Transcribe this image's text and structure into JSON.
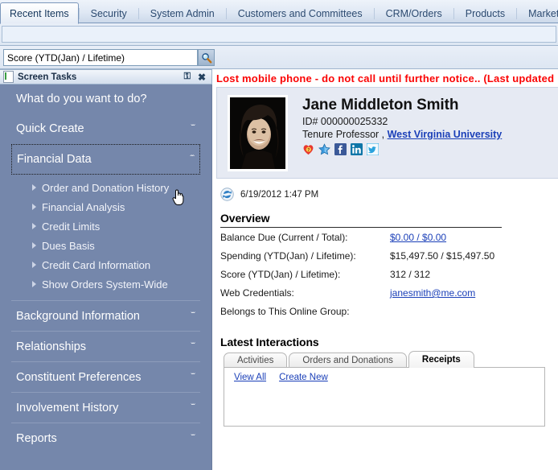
{
  "window": {
    "tabs": [
      {
        "label": "Recent Items",
        "active": true
      },
      {
        "label": "Security",
        "active": false
      },
      {
        "label": "System Admin",
        "active": false
      },
      {
        "label": "Customers and Committees",
        "active": false
      },
      {
        "label": "CRM/Orders",
        "active": false
      },
      {
        "label": "Products",
        "active": false
      },
      {
        "label": "Marketing",
        "active": false
      }
    ]
  },
  "search": {
    "value": "Score (YTD(Jan) / Lifetime)",
    "placeholder": "",
    "button_icon": "magnifier-icon"
  },
  "sidebar": {
    "panel_title": "Screen Tasks",
    "panel_icon": "document-icon",
    "pin_icon": "pin-icon",
    "close_icon": "close-icon",
    "question": "What do you want to do?",
    "sections": [
      {
        "label": "Quick Create",
        "expanded": false,
        "chevron": "ˇˇ"
      },
      {
        "label": "Financial Data",
        "expanded": true,
        "chevron": "ˆˆ"
      },
      {
        "label": "Background Information",
        "expanded": false,
        "chevron": "ˇˇ"
      },
      {
        "label": "Relationships",
        "expanded": false,
        "chevron": "ˇˇ"
      },
      {
        "label": "Constituent Preferences",
        "expanded": false,
        "chevron": "ˇˇ"
      },
      {
        "label": "Involvement History",
        "expanded": false,
        "chevron": "ˇˇ"
      },
      {
        "label": "Reports",
        "expanded": false,
        "chevron": "ˇˇ"
      }
    ],
    "financial_items": [
      {
        "label": "Order and Donation History"
      },
      {
        "label": "Financial Analysis"
      },
      {
        "label": "Credit Limits"
      },
      {
        "label": "Dues Basis"
      },
      {
        "label": "Credit Card Information"
      },
      {
        "label": "Show Orders System-Wide"
      }
    ]
  },
  "main": {
    "alert_text": "Lost mobile phone - do not call until further notice.. (Last updated",
    "alert_color": "#fb0404",
    "profile": {
      "name": "Jane Middleton Smith",
      "id": "ID# 000000025332",
      "role_prefix": "Tenure Professor , ",
      "organization": "West Virginia University",
      "avatar_alt": "portrait-photo",
      "social": [
        {
          "name": "heart-question-icon"
        },
        {
          "name": "star-icon"
        },
        {
          "name": "facebook-icon"
        },
        {
          "name": "linkedin-icon"
        },
        {
          "name": "twitter-icon"
        }
      ]
    },
    "timestamp": "6/19/2012 1:47 PM",
    "refresh_icon": "refresh-icon",
    "overview": {
      "title": "Overview",
      "rows": [
        {
          "label": "Balance Due (Current / Total):",
          "value": "$0.00 / $0.00",
          "is_link": true
        },
        {
          "label": "Spending (YTD(Jan) / Lifetime):",
          "value": "$15,497.50 / $15,497.50",
          "is_link": false
        },
        {
          "label": "Score (YTD(Jan) / Lifetime):",
          "value": "312 / 312",
          "is_link": false
        },
        {
          "label": "Web Credentials:",
          "value": "janesmith@me.com",
          "is_link": true
        },
        {
          "label": "Belongs to This Online Group:",
          "value": "",
          "is_link": false
        }
      ]
    },
    "interactions": {
      "title": "Latest Interactions",
      "tabs": [
        {
          "label": "Activities",
          "active": false
        },
        {
          "label": "Orders and Donations",
          "active": false
        },
        {
          "label": "Receipts",
          "active": true
        }
      ],
      "links": [
        {
          "label": "View All"
        },
        {
          "label": "Create New"
        }
      ]
    }
  }
}
